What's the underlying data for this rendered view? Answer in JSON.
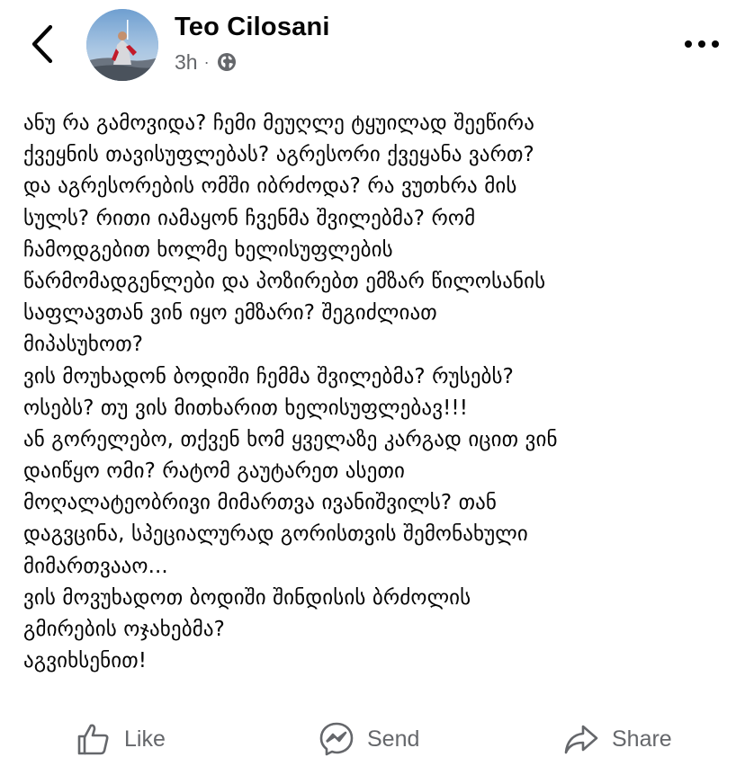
{
  "header": {
    "back_icon": "chevron-left-icon",
    "author_name": "Teo Cilosani",
    "time": "3h",
    "separator": "·",
    "audience_icon": "globe-icon",
    "more_icon": "ellipsis-icon"
  },
  "post": {
    "lines": [
      "ანუ რა გამოვიდა? ჩემი მეუღლე ტყუილად შეეწირა",
      "ქვეყნის თავისუფლებას? აგრესორი ქვეყანა ვართ?",
      "და აგრესორების ომში იბრძოდა? რა ვუთხრა მის",
      "სულს? რითი იამაყონ ჩვენმა შვილებმა? რომ",
      "ჩამოდგებით ხოლმე ხელისუფლების",
      "წარმომადგენლები და პოზირებთ ემზარ წილოსანის",
      "საფლავთან ვინ იყო ემზარი? შეგიძლიათ",
      "მიპასუხოთ?",
      "ვის მოუხადონ ბოდიში ჩემმა შვილებმა? რუსებს?",
      "ოსებს? თუ ვის მითხარით ხელისუფლებავ!!!",
      "ან გორელებო, თქვენ ხომ ყველაზე კარგად იცით ვინ",
      "დაიწყო ომი? რატომ გაუტარეთ ასეთი",
      "მოღალატეობრივი მიმართვა ივანიშვილს? თან",
      "დაგვცინა, სპეციალურად გორისთვის შემონახული",
      "მიმართვააო...",
      "ვის მოვუხადოთ ბოდიში შინდისის ბრძოლის",
      "გმირების ოჯახებმა?",
      "აგვიხსენით!"
    ]
  },
  "actions": {
    "like_label": "Like",
    "send_label": "Send",
    "share_label": "Share",
    "like_icon": "thumbs-up-icon",
    "send_icon": "messenger-icon",
    "share_icon": "share-arrow-icon"
  },
  "colors": {
    "text": "#050505",
    "secondary": "#65676b",
    "background": "#ffffff"
  }
}
